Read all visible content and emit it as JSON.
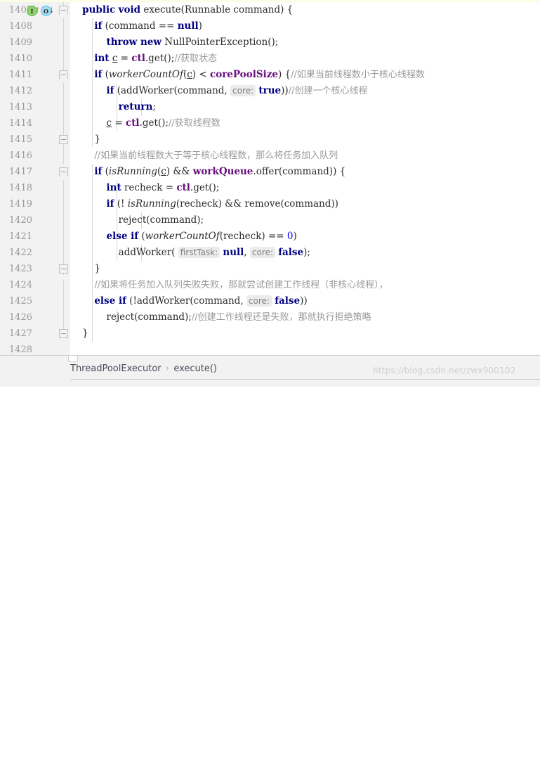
{
  "editor": {
    "first_line_number": 1407,
    "line_count": 22,
    "line_numbers": [
      1407,
      1408,
      1409,
      1410,
      1411,
      1412,
      1413,
      1414,
      1415,
      1416,
      1417,
      1418,
      1419,
      1420,
      1421,
      1422,
      1423,
      1424,
      1425,
      1426,
      1427,
      1428
    ],
    "gutter_icons": [
      {
        "name": "implementing-method-icon",
        "glyph": "I",
        "color": "#62b543",
        "arrow": "↑",
        "arrow_color": "#e05252",
        "line": 1407
      },
      {
        "name": "overriding-method-icon",
        "glyph": "O",
        "color": "#52c0e5",
        "arrow": "↓",
        "arrow_color": "#3c3c3c",
        "line": 1407
      }
    ],
    "fold_marker_lines": [
      1407,
      1411,
      1415,
      1417,
      1423,
      1427
    ],
    "colors": {
      "keyword": "#000080",
      "number": "#0000ff",
      "static_field": "#660e7a",
      "comment": "#9a9a9a",
      "plain": "#2b2b2b",
      "hint_background": "#ebebeb",
      "hint_text": "#808080",
      "gutter_background": "#f2f2f2",
      "editor_background": "#ffffff"
    },
    "lines": [
      {
        "n": 1407,
        "text": "    public void execute(Runnable command) {"
      },
      {
        "n": 1408,
        "text": "        if (command == null)"
      },
      {
        "n": 1409,
        "text": "            throw new NullPointerException();"
      },
      {
        "n": 1410,
        "text": "        int c = ctl.get();//获取状态"
      },
      {
        "n": 1411,
        "text": "        if (workerCountOf(c) < corePoolSize) {//如果当前线程数小于核心线程数"
      },
      {
        "n": 1412,
        "text": "            if (addWorker(command, core: true))//创建一个核心线程"
      },
      {
        "n": 1413,
        "text": "                return;"
      },
      {
        "n": 1414,
        "text": "            c = ctl.get();//获取线程数"
      },
      {
        "n": 1415,
        "text": "        }"
      },
      {
        "n": 1416,
        "text": "        //如果当前线程数大于等于核心线程数，那么将任务加入队列"
      },
      {
        "n": 1417,
        "text": "        if (isRunning(c) && workQueue.offer(command)) {"
      },
      {
        "n": 1418,
        "text": "            int recheck = ctl.get();"
      },
      {
        "n": 1419,
        "text": "            if (! isRunning(recheck) && remove(command))"
      },
      {
        "n": 1420,
        "text": "                reject(command);"
      },
      {
        "n": 1421,
        "text": "            else if (workerCountOf(recheck) == 0)"
      },
      {
        "n": 1422,
        "text": "                addWorker( firstTask: null, core: false);"
      },
      {
        "n": 1423,
        "text": "        }"
      },
      {
        "n": 1424,
        "text": "        //如果将任务加入队列失败失败，那就尝试创建工作线程（非核心线程），"
      },
      {
        "n": 1425,
        "text": "        else if (!addWorker(command, core: false))"
      },
      {
        "n": 1426,
        "text": "            reject(command);//创建工作线程还是失败，那就执行拒绝策略"
      },
      {
        "n": 1427,
        "text": "    }"
      },
      {
        "n": 1428,
        "text": ""
      }
    ],
    "parameter_hints": [
      {
        "label": "core:",
        "line": 1412
      },
      {
        "label": "firstTask:",
        "line": 1422
      },
      {
        "label": "core:",
        "line": 1422
      },
      {
        "label": "core:",
        "line": 1425
      }
    ]
  },
  "breadcrumb": {
    "items": [
      {
        "label": "ThreadPoolExecutor"
      },
      {
        "label": "execute()"
      }
    ],
    "separator": "›"
  },
  "watermark": {
    "text": "https://blog.csdn.net/zwx900102"
  }
}
